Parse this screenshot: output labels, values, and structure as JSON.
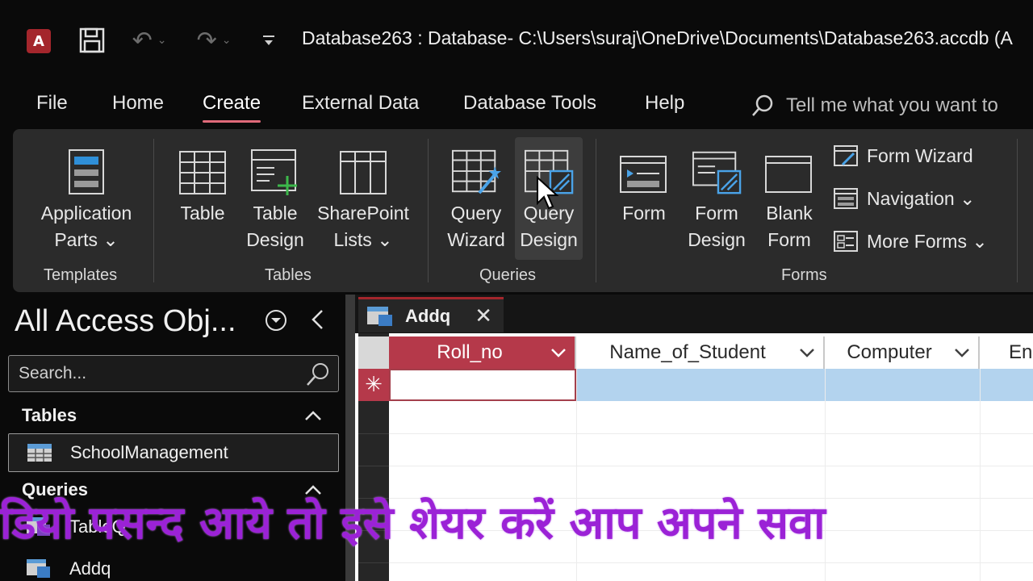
{
  "titlebar": {
    "app_logo": "A",
    "title": "Database263 : Database- C:\\Users\\suraj\\OneDrive\\Documents\\Database263.accdb (A"
  },
  "menu": {
    "tabs": [
      "File",
      "Home",
      "Create",
      "External Data",
      "Database Tools",
      "Help"
    ],
    "active_tab": "Create",
    "tell_me": "Tell me what you want to"
  },
  "ribbon": {
    "templates": {
      "application_parts": "Application",
      "application_parts2": "Parts ⌄",
      "label": "Templates"
    },
    "tables": {
      "table": "Table",
      "table_design1": "Table",
      "table_design2": "Design",
      "sharepoint1": "SharePoint",
      "sharepoint2": "Lists ⌄",
      "label": "Tables"
    },
    "queries": {
      "wizard1": "Query",
      "wizard2": "Wizard",
      "design1": "Query",
      "design2": "Design",
      "label": "Queries"
    },
    "forms": {
      "form": "Form",
      "form_design1": "Form",
      "form_design2": "Design",
      "blank1": "Blank",
      "blank2": "Form",
      "form_wizard": "Form Wizard",
      "navigation": "Navigation ⌄",
      "more_forms": "More Forms ⌄",
      "label": "Forms"
    }
  },
  "nav": {
    "title": "All Access Obj...",
    "search_placeholder": "Search...",
    "sections": [
      {
        "label": "Tables",
        "items": [
          "SchoolManagement"
        ]
      },
      {
        "label": "Queries",
        "items": [
          "TableQ",
          "Addq"
        ]
      }
    ]
  },
  "document": {
    "tab_label": "Addq",
    "columns": [
      "Roll_no",
      "Name_of_Student",
      "Computer",
      "En"
    ],
    "new_row_marker": "✳"
  },
  "overlay_caption": "डियो पसन्द आये तो इसे शेयर करें आप अपने सवा",
  "colors": {
    "accent": "#a4262c",
    "active_tab_underline": "#e06a7a",
    "header_active": "#b5394a",
    "new_row": "#b3d3ee",
    "caption": "#9b22d6"
  }
}
